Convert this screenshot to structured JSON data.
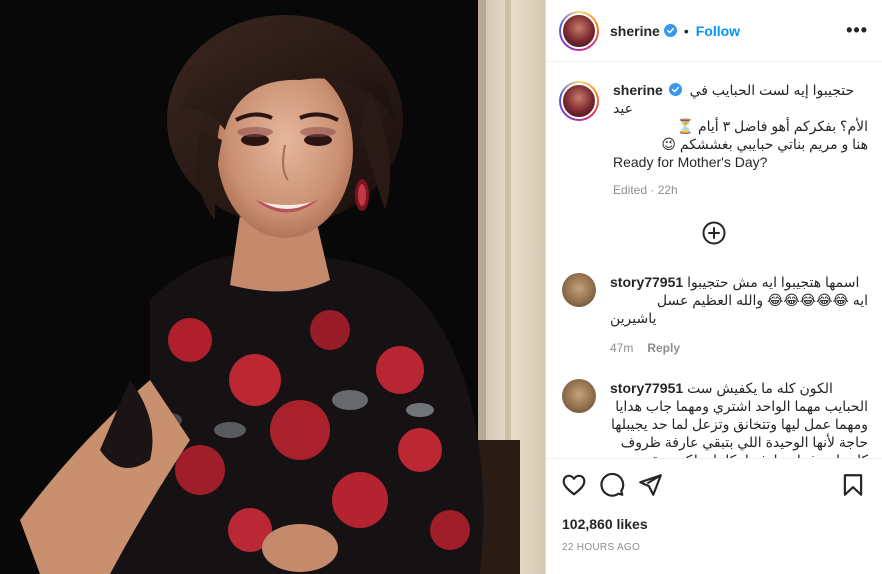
{
  "post": {
    "username": "sherine",
    "separator": "•",
    "follow_label": "Follow",
    "more_label": "•••"
  },
  "caption": {
    "username": "sherine",
    "lines": [
      "حتجيبوا إيه لست الحبايب في عيد",
      "الأم؟ بفكركم أهو فاضل ٣ أيام ⏳",
      "هنا و مريم بناتي حبايبي بغششكم 😉",
      "Ready for Mother's Day?"
    ],
    "meta": "Edited · 22h"
  },
  "comments": [
    {
      "username": "story77951",
      "lines": [
        "اسمها هتجيبوا ايه مش حتجيبوا",
        "ايه 😂😂😂😂😂 والله العظيم عسل",
        "ياشيرين"
      ],
      "age": "47m",
      "reply_label": "Reply"
    },
    {
      "username": "story77951",
      "lines": [
        "الكون كله ما يكفيش ست",
        "الحبايب مهما الواحد اشتري ومهما جاب هدايا",
        "ومهما عمل ليها وتتخانق وتزعل لما حد يجيبلها",
        "حاجة لأنها الوحيدة اللي بتبقي عارفة ظروف",
        "كل واحد فينا وعارفة امكانياته لكن بتبقي"
      ]
    }
  ],
  "likes": "102,860 likes",
  "timestamp": "22 HOURS AGO",
  "icons": {
    "verified": "verified-badge-icon",
    "like": "heart-icon",
    "comment": "comment-bubble-icon",
    "share": "paper-plane-icon",
    "save": "bookmark-icon",
    "load_more": "plus-circle-icon"
  },
  "colors": {
    "accent": "#0095f6",
    "muted": "#8e8e8e",
    "text": "#262626"
  }
}
